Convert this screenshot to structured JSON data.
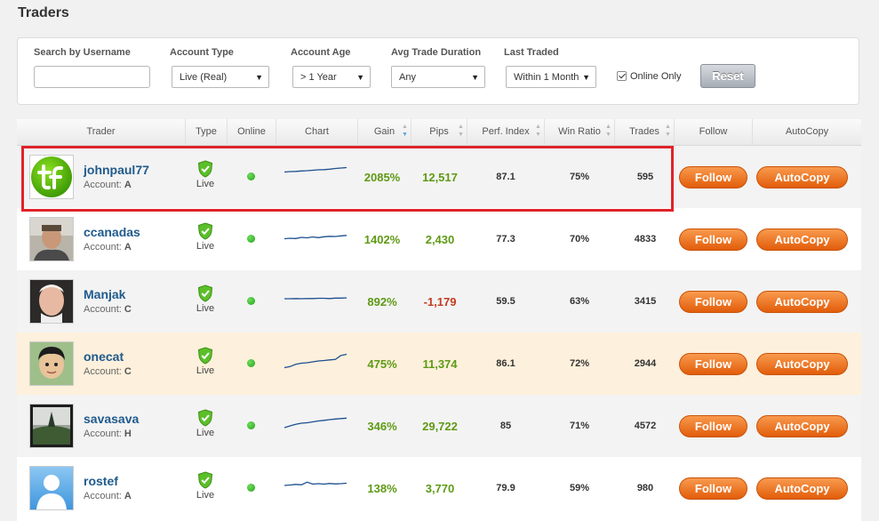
{
  "page": {
    "title": "Traders"
  },
  "filters": {
    "search_label": "Search by Username",
    "search_value": "",
    "account_type_label": "Account Type",
    "account_type_value": "Live (Real)",
    "account_age_label": "Account Age",
    "account_age_value": "> 1 Year",
    "avg_trade_duration_label": "Avg Trade Duration",
    "avg_trade_duration_value": "Any",
    "last_traded_label": "Last Traded",
    "last_traded_value": "Within 1 Month",
    "online_only_label": "Online Only",
    "online_only_checked": true,
    "reset_label": "Reset"
  },
  "table": {
    "columns": {
      "trader": "Trader",
      "type": "Type",
      "online": "Online",
      "chart": "Chart",
      "gain": "Gain",
      "pips": "Pips",
      "perf_index": "Perf. Index",
      "win_ratio": "Win Ratio",
      "trades": "Trades",
      "follow": "Follow",
      "autocopy": "AutoCopy"
    },
    "account_prefix": "Account:",
    "live_label": "Live",
    "follow_label": "Follow",
    "autocopy_label": "AutoCopy",
    "rows": [
      {
        "name": "johnpaul77",
        "account": "A",
        "gain": "2085%",
        "pips": "12,517",
        "perf_index": "87.1",
        "win_ratio": "75%",
        "trades": "595",
        "avatar": "logo-tf",
        "sparkline": [
          5,
          5.2,
          5.3,
          5.5,
          5.6,
          5.8,
          6,
          6.1,
          6.3,
          6.6,
          6.8,
          7
        ]
      },
      {
        "name": "ccanadas",
        "account": "A",
        "gain": "1402%",
        "pips": "2,430",
        "perf_index": "77.3",
        "win_ratio": "70%",
        "trades": "4833",
        "avatar": "photo-man",
        "sparkline": [
          3,
          3.2,
          3.1,
          3.6,
          3.4,
          3.8,
          3.5,
          3.9,
          4.1,
          4,
          4.3,
          4.5
        ]
      },
      {
        "name": "Manjak",
        "account": "C",
        "gain": "892%",
        "pips": "-1,179",
        "perf_index": "59.5",
        "win_ratio": "63%",
        "trades": "3415",
        "avatar": "photo-older-man",
        "sparkline": [
          4,
          4,
          4.1,
          4,
          4.1,
          4.1,
          4.2,
          4.2,
          4.1,
          4.3,
          4.3,
          4.4
        ]
      },
      {
        "name": "onecat",
        "account": "C",
        "gain": "475%",
        "pips": "11,374",
        "perf_index": "86.1",
        "win_ratio": "72%",
        "trades": "2944",
        "avatar": "photo-child",
        "sparkline": [
          1,
          1.5,
          2.5,
          3,
          3.2,
          3.6,
          4,
          4.2,
          4.5,
          4.7,
          6.5,
          7
        ]
      },
      {
        "name": "savasava",
        "account": "H",
        "gain": "346%",
        "pips": "29,722",
        "perf_index": "85",
        "win_ratio": "71%",
        "trades": "4572",
        "avatar": "photo-landscape",
        "sparkline": [
          2,
          2.8,
          3.5,
          4,
          4.2,
          4.6,
          5,
          5.3,
          5.6,
          5.9,
          6.1,
          6.3
        ]
      },
      {
        "name": "rostef",
        "account": "A",
        "gain": "138%",
        "pips": "3,770",
        "perf_index": "79.9",
        "win_ratio": "59%",
        "trades": "980",
        "avatar": "default-avatar",
        "sparkline": [
          4,
          4.2,
          4.5,
          4.3,
          5.5,
          4.6,
          4.8,
          4.6,
          4.9,
          4.7,
          4.8,
          5
        ]
      }
    ]
  },
  "colors": {
    "accent_orange": "#e8701f",
    "gain_green": "#5e9a14",
    "negative_red": "#c23a20",
    "name_blue": "#1f5a8c",
    "highlight_red": "#e0232a"
  }
}
